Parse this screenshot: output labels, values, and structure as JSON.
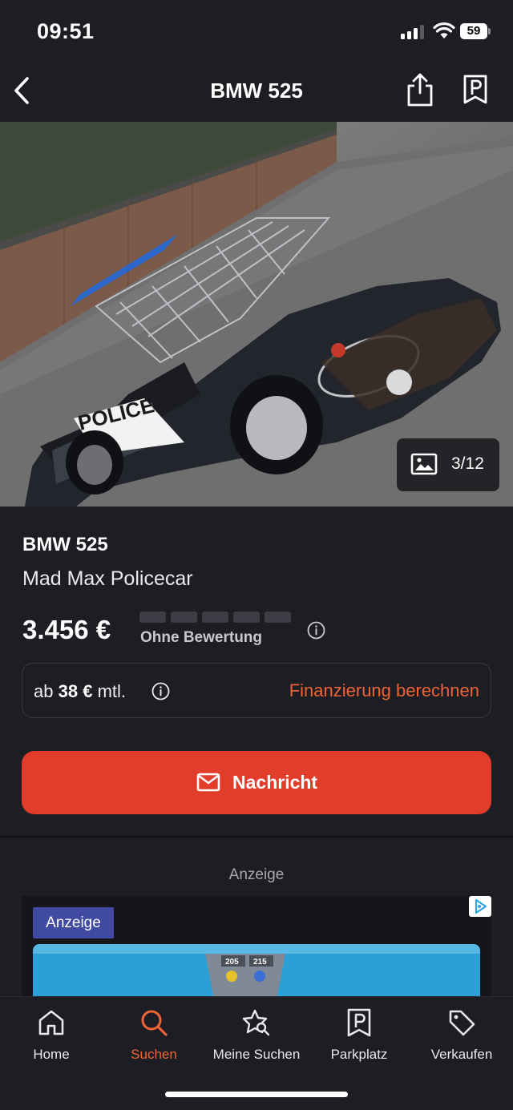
{
  "status_bar": {
    "time": "09:51",
    "battery": "59"
  },
  "nav": {
    "title": "BMW 525"
  },
  "gallery": {
    "counter": "3/12"
  },
  "listing": {
    "title": "BMW 525",
    "subtitle": "Mad Max Policecar",
    "price": "3.456 €",
    "rating_label": "Ohne Bewertung",
    "rating_filled": 0,
    "rating_max": 5
  },
  "financing": {
    "prefix": "ab",
    "amount": "38 €",
    "suffix": "mtl.",
    "link": "Finanzierung berechnen"
  },
  "actions": {
    "message_label": "Nachricht"
  },
  "ad": {
    "heading": "Anzeige",
    "badge": "Anzeige",
    "sign_left": "205",
    "sign_right": "215"
  },
  "tabs": [
    {
      "label": "Home",
      "icon": "home-icon",
      "active": false
    },
    {
      "label": "Suchen",
      "icon": "search-icon",
      "active": true
    },
    {
      "label": "Meine Suchen",
      "icon": "saved-search-icon",
      "active": false
    },
    {
      "label": "Parkplatz",
      "icon": "parking-icon",
      "active": false
    },
    {
      "label": "Verkaufen",
      "icon": "tag-icon",
      "active": false
    }
  ],
  "colors": {
    "accent": "#ee6437",
    "button": "#e23c2a",
    "background": "#1d1d24",
    "ad_badge": "#3f4aa0"
  }
}
